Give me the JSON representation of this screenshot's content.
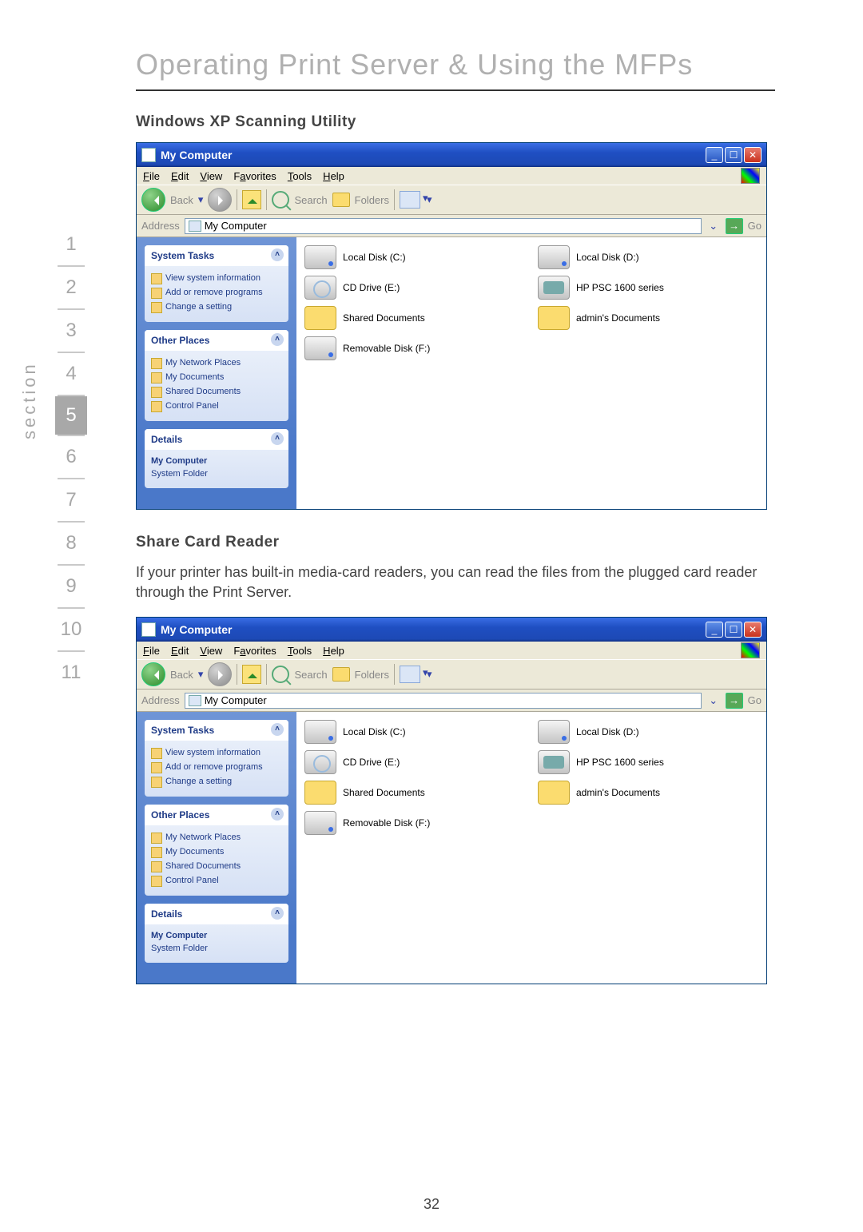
{
  "page_title": "Operating Print Server & Using the MFPs",
  "heading1": "Windows XP Scanning Utility",
  "heading2": "Share Card Reader",
  "body_text": "If your printer has built-in media-card readers, you can read the files from the plugged card reader through the Print Server.",
  "page_number": "32",
  "section_label": "section",
  "nav": {
    "items": [
      "1",
      "2",
      "3",
      "4",
      "5",
      "6",
      "7",
      "8",
      "9",
      "10",
      "11"
    ],
    "current": "5"
  },
  "xp_window": {
    "title": "My Computer",
    "menu": {
      "file": "File",
      "edit": "Edit",
      "view": "View",
      "favorites": "Favorites",
      "tools": "Tools",
      "help": "Help"
    },
    "toolbar": {
      "back": "Back",
      "search": "Search",
      "folders": "Folders"
    },
    "addressbar": {
      "label": "Address",
      "value": "My Computer",
      "go": "Go"
    },
    "sidebar": {
      "system_tasks": {
        "title": "System Tasks",
        "links": [
          "View system information",
          "Add or remove programs",
          "Change a setting"
        ]
      },
      "other_places": {
        "title": "Other Places",
        "links": [
          "My Network Places",
          "My Documents",
          "Shared Documents",
          "Control Panel"
        ]
      },
      "details": {
        "title": "Details",
        "name": "My Computer",
        "type": "System Folder"
      }
    },
    "content": {
      "items": [
        {
          "label": "Local Disk (C:)",
          "type": "hdd"
        },
        {
          "label": "Local Disk (D:)",
          "type": "hdd"
        },
        {
          "label": "CD Drive (E:)",
          "type": "cd"
        },
        {
          "label": "HP PSC 1600 series",
          "type": "dev"
        },
        {
          "label": "Shared Documents",
          "type": "fld"
        },
        {
          "label": "admin's Documents",
          "type": "fld"
        },
        {
          "label": "Removable Disk (F:)",
          "type": "hdd"
        }
      ]
    }
  }
}
